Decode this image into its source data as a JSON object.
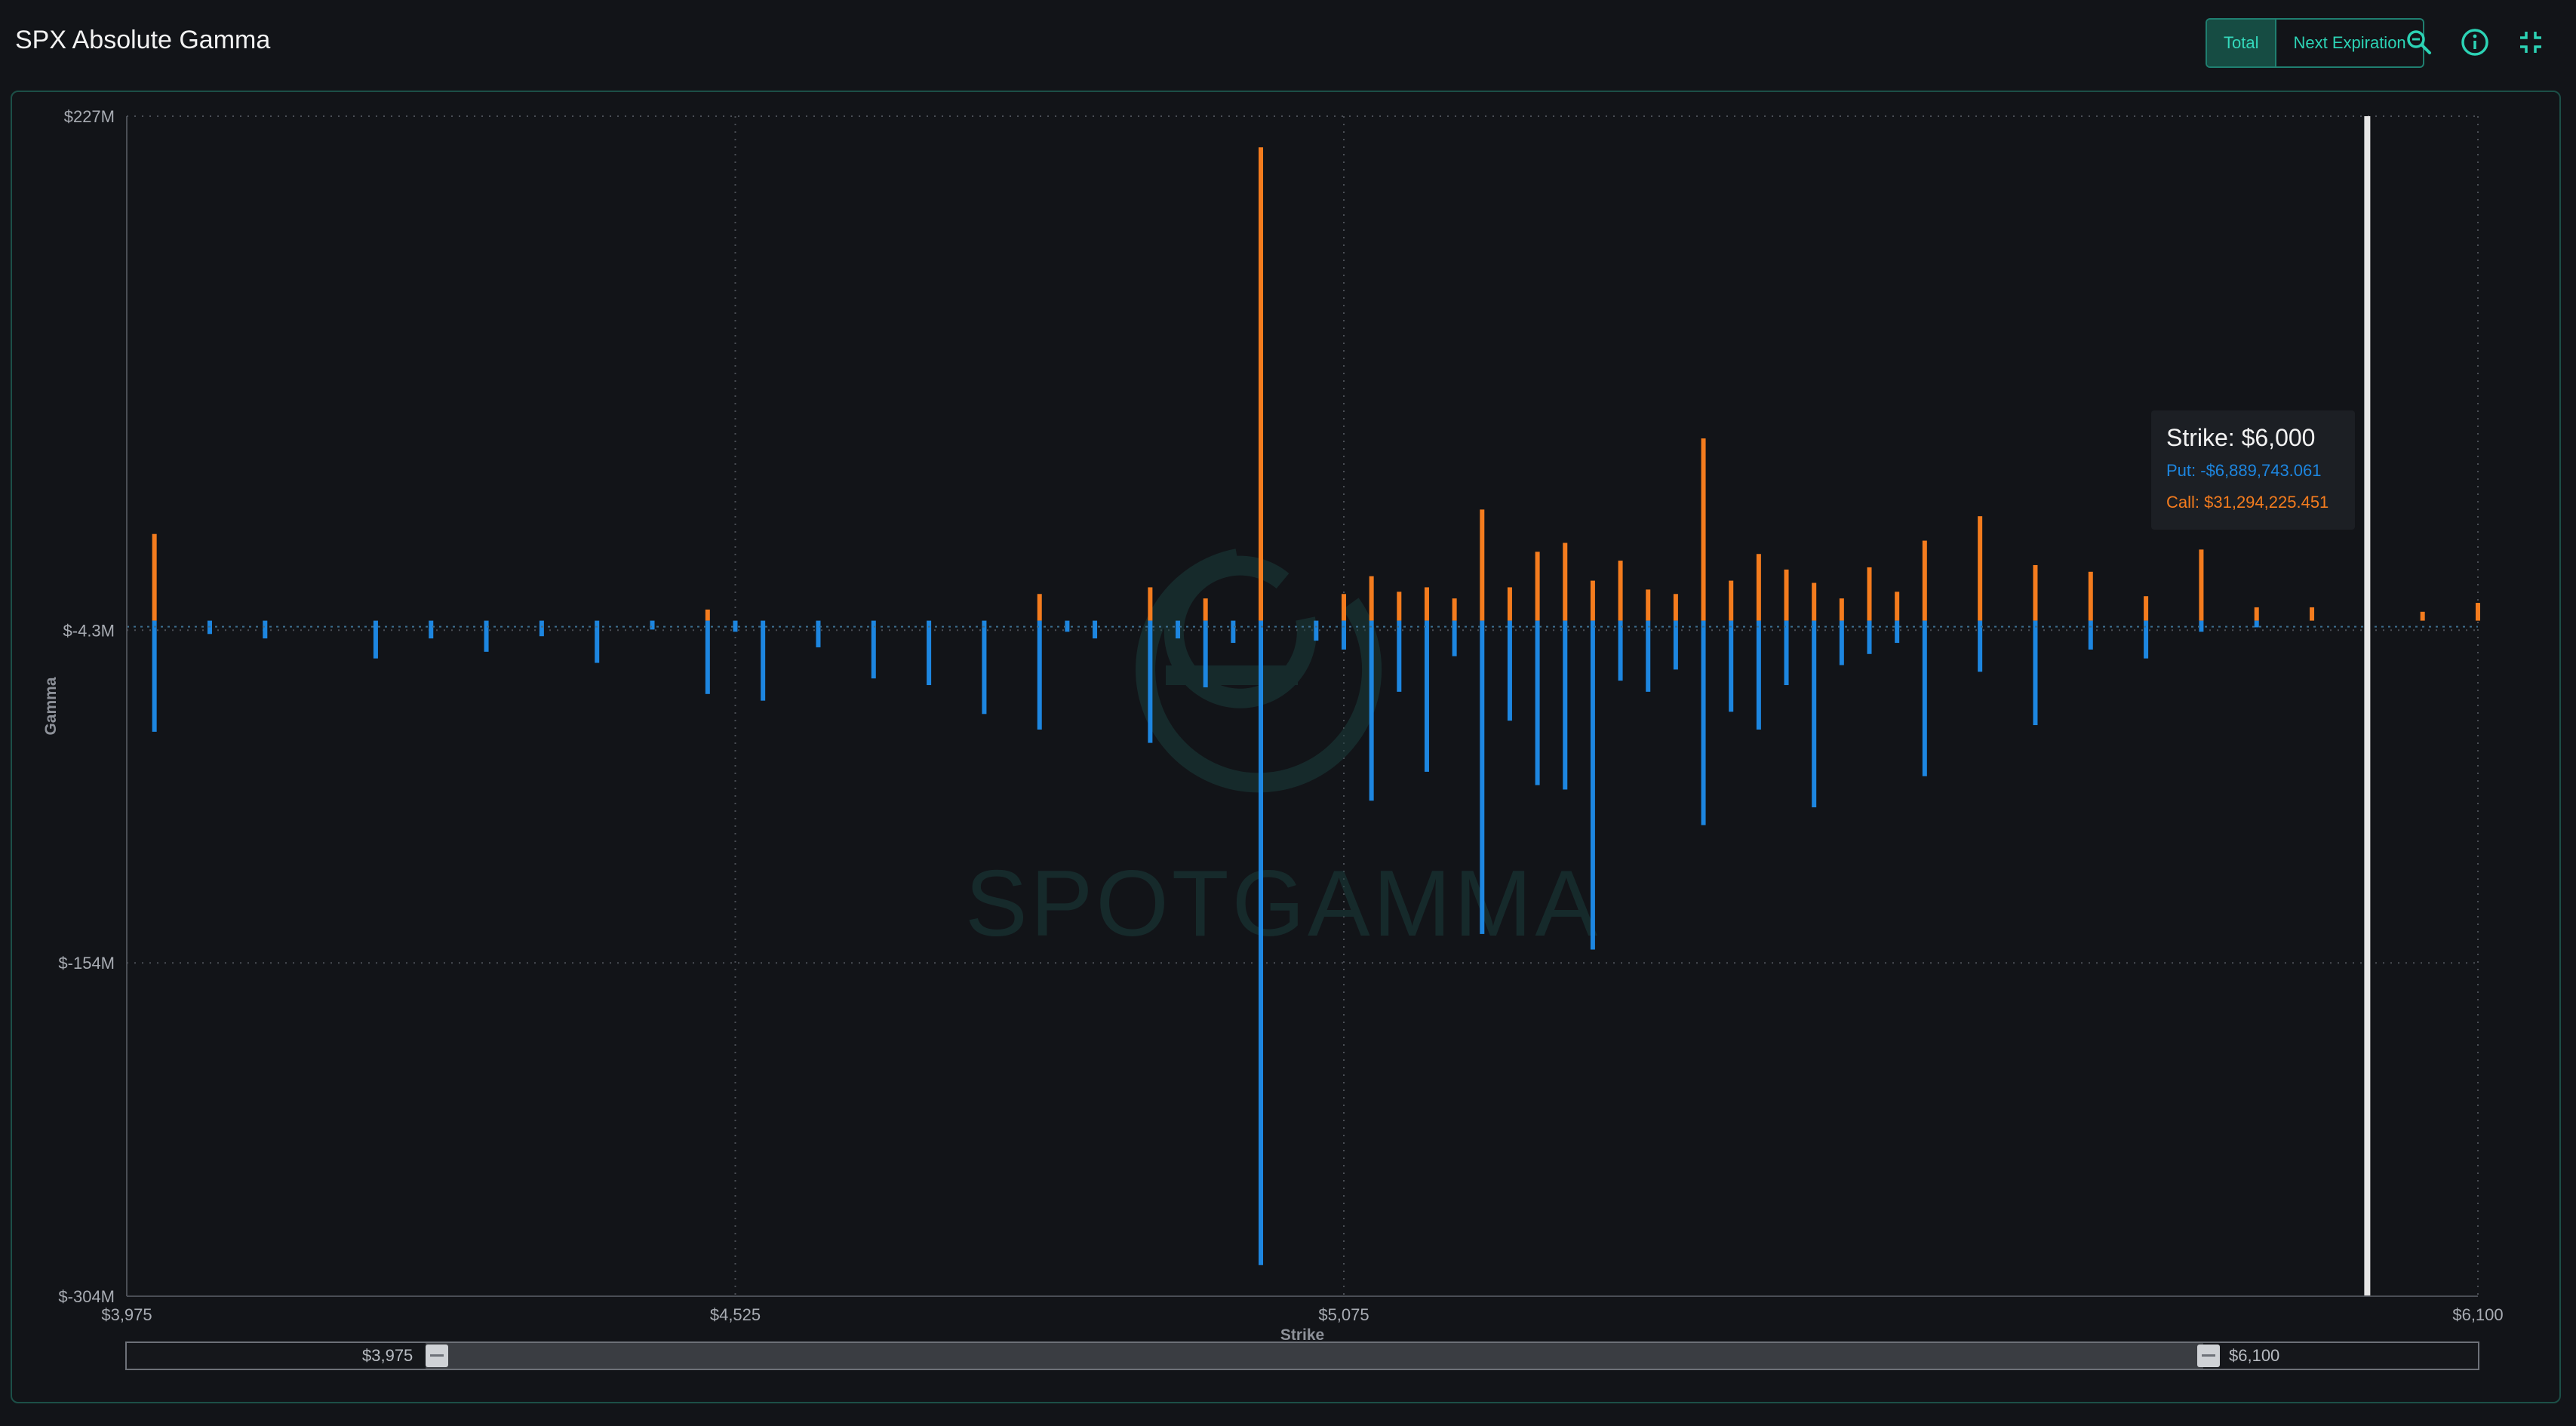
{
  "header": {
    "title": "SPX Absolute Gamma",
    "toggle": {
      "total_label": "Total",
      "next_expiration_label": "Next Expiration",
      "active": "total"
    },
    "icons": [
      "zoom-icon",
      "info-icon",
      "collapse-icon"
    ]
  },
  "colors": {
    "accent": "#2cd3b5",
    "put": "#1d86e0",
    "call": "#f47c1e",
    "background": "#121418",
    "cursor": "#e6e6e6"
  },
  "watermark": {
    "text": "SPOTGAMMA"
  },
  "tooltip": {
    "title": "Strike: $6,000",
    "put": "Put: -$6,889,743.061",
    "call": "Call: $31,294,225.451"
  },
  "range_selector": {
    "min_label": "$3,975",
    "max_label": "$6,100"
  },
  "chart_data": {
    "type": "bar",
    "title": "SPX Absolute Gamma",
    "xlabel": "Strike",
    "ylabel": "Gamma",
    "xlim": [
      3975,
      6100
    ],
    "ylim": [
      -304,
      227
    ],
    "y_unit": "$M",
    "x_ticks": [
      3975,
      4525,
      5075,
      6100
    ],
    "x_tick_labels": [
      "$3,975",
      "$4,525",
      "$5,075",
      "$6,100"
    ],
    "y_ticks": [
      227,
      -4.3,
      -154,
      -304
    ],
    "y_tick_labels": [
      "$227M",
      "$-4.3M",
      "$-154M",
      "$-304M"
    ],
    "grid": true,
    "cursor_strike": 6000,
    "series": [
      {
        "name": "Call",
        "color": "#f47c1e",
        "points": [
          [
            4000,
            39
          ],
          [
            4500,
            5
          ],
          [
            4800,
            12
          ],
          [
            4900,
            15
          ],
          [
            4950,
            10
          ],
          [
            5000,
            213
          ],
          [
            5075,
            12
          ],
          [
            5100,
            20
          ],
          [
            5125,
            13
          ],
          [
            5150,
            15
          ],
          [
            5175,
            10
          ],
          [
            5200,
            50
          ],
          [
            5225,
            15
          ],
          [
            5250,
            31
          ],
          [
            5275,
            35
          ],
          [
            5300,
            18
          ],
          [
            5325,
            27
          ],
          [
            5350,
            14
          ],
          [
            5375,
            12
          ],
          [
            5400,
            82
          ],
          [
            5425,
            18
          ],
          [
            5450,
            30
          ],
          [
            5475,
            23
          ],
          [
            5500,
            17
          ],
          [
            5525,
            10
          ],
          [
            5550,
            24
          ],
          [
            5575,
            13
          ],
          [
            5600,
            36
          ],
          [
            5650,
            47
          ],
          [
            5700,
            25
          ],
          [
            5750,
            22
          ],
          [
            5800,
            11
          ],
          [
            5850,
            32
          ],
          [
            5900,
            6
          ],
          [
            5950,
            6
          ],
          [
            6000,
            31
          ],
          [
            6050,
            4
          ],
          [
            6100,
            8
          ]
        ]
      },
      {
        "name": "Put",
        "color": "#1d86e0",
        "points": [
          [
            4000,
            -50
          ],
          [
            4050,
            -6
          ],
          [
            4100,
            -8
          ],
          [
            4200,
            -17
          ],
          [
            4250,
            -8
          ],
          [
            4300,
            -14
          ],
          [
            4350,
            -7
          ],
          [
            4400,
            -19
          ],
          [
            4450,
            -4
          ],
          [
            4500,
            -33
          ],
          [
            4525,
            -5
          ],
          [
            4550,
            -36
          ],
          [
            4600,
            -12
          ],
          [
            4650,
            -26
          ],
          [
            4700,
            -29
          ],
          [
            4750,
            -42
          ],
          [
            4800,
            -49
          ],
          [
            4825,
            -5
          ],
          [
            4850,
            -8
          ],
          [
            4900,
            -55
          ],
          [
            4925,
            -8
          ],
          [
            4950,
            -30
          ],
          [
            4975,
            -10
          ],
          [
            5000,
            -290
          ],
          [
            5050,
            -9
          ],
          [
            5075,
            -13
          ],
          [
            5100,
            -81
          ],
          [
            5125,
            -32
          ],
          [
            5150,
            -68
          ],
          [
            5175,
            -16
          ],
          [
            5200,
            -141
          ],
          [
            5225,
            -45
          ],
          [
            5250,
            -74
          ],
          [
            5275,
            -76
          ],
          [
            5300,
            -148
          ],
          [
            5325,
            -27
          ],
          [
            5350,
            -32
          ],
          [
            5375,
            -22
          ],
          [
            5400,
            -92
          ],
          [
            5425,
            -41
          ],
          [
            5450,
            -49
          ],
          [
            5475,
            -29
          ],
          [
            5500,
            -84
          ],
          [
            5525,
            -20
          ],
          [
            5550,
            -15
          ],
          [
            5575,
            -10
          ],
          [
            5600,
            -70
          ],
          [
            5650,
            -23
          ],
          [
            5700,
            -47
          ],
          [
            5750,
            -13
          ],
          [
            5800,
            -17
          ],
          [
            5850,
            -5
          ],
          [
            5900,
            -3
          ],
          [
            6000,
            -7
          ]
        ]
      }
    ]
  }
}
